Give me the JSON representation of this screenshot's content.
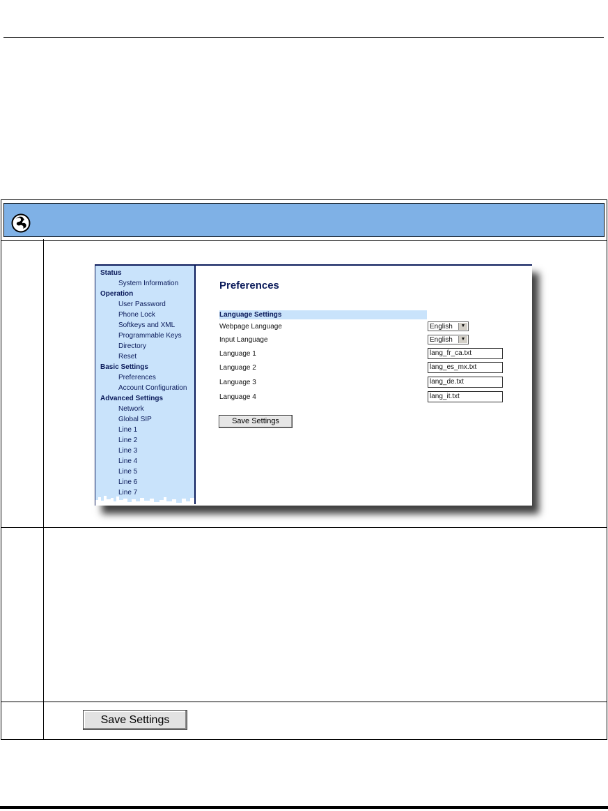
{
  "nav": {
    "items": [
      {
        "label": "Status",
        "type": "section"
      },
      {
        "label": "System Information",
        "type": "sub"
      },
      {
        "label": "Operation",
        "type": "section"
      },
      {
        "label": "User Password",
        "type": "sub"
      },
      {
        "label": "Phone Lock",
        "type": "sub"
      },
      {
        "label": "Softkeys and XML",
        "type": "sub"
      },
      {
        "label": "Programmable Keys",
        "type": "sub"
      },
      {
        "label": "Directory",
        "type": "sub"
      },
      {
        "label": "Reset",
        "type": "sub"
      },
      {
        "label": "Basic Settings",
        "type": "section"
      },
      {
        "label": "Preferences",
        "type": "sub"
      },
      {
        "label": "Account Configuration",
        "type": "sub"
      },
      {
        "label": "Advanced Settings",
        "type": "section"
      },
      {
        "label": "Network",
        "type": "sub"
      },
      {
        "label": "Global SIP",
        "type": "sub"
      },
      {
        "label": "Line 1",
        "type": "sub"
      },
      {
        "label": "Line 2",
        "type": "sub"
      },
      {
        "label": "Line 3",
        "type": "sub"
      },
      {
        "label": "Line 4",
        "type": "sub"
      },
      {
        "label": "Line 5",
        "type": "sub"
      },
      {
        "label": "Line 6",
        "type": "sub"
      },
      {
        "label": "Line 7",
        "type": "sub"
      }
    ]
  },
  "page": {
    "title": "Preferences",
    "section_header": "Language Settings",
    "fields": {
      "webpage_language": {
        "label": "Webpage Language",
        "value": "English"
      },
      "input_language": {
        "label": "Input Language",
        "value": "English"
      },
      "language_1": {
        "label": "Language 1",
        "value": "lang_fr_ca.txt"
      },
      "language_2": {
        "label": "Language 2",
        "value": "lang_es_mx.txt"
      },
      "language_3": {
        "label": "Language 3",
        "value": "lang_de.txt"
      },
      "language_4": {
        "label": "Language 4",
        "value": "lang_it.txt"
      }
    },
    "save_label": "Save Settings"
  },
  "step3": {
    "save_label": "Save Settings"
  },
  "colors": {
    "header_band": "#7fb1e6",
    "nav_bg": "#c9e3fb",
    "nav_text": "#0a1a5a"
  }
}
